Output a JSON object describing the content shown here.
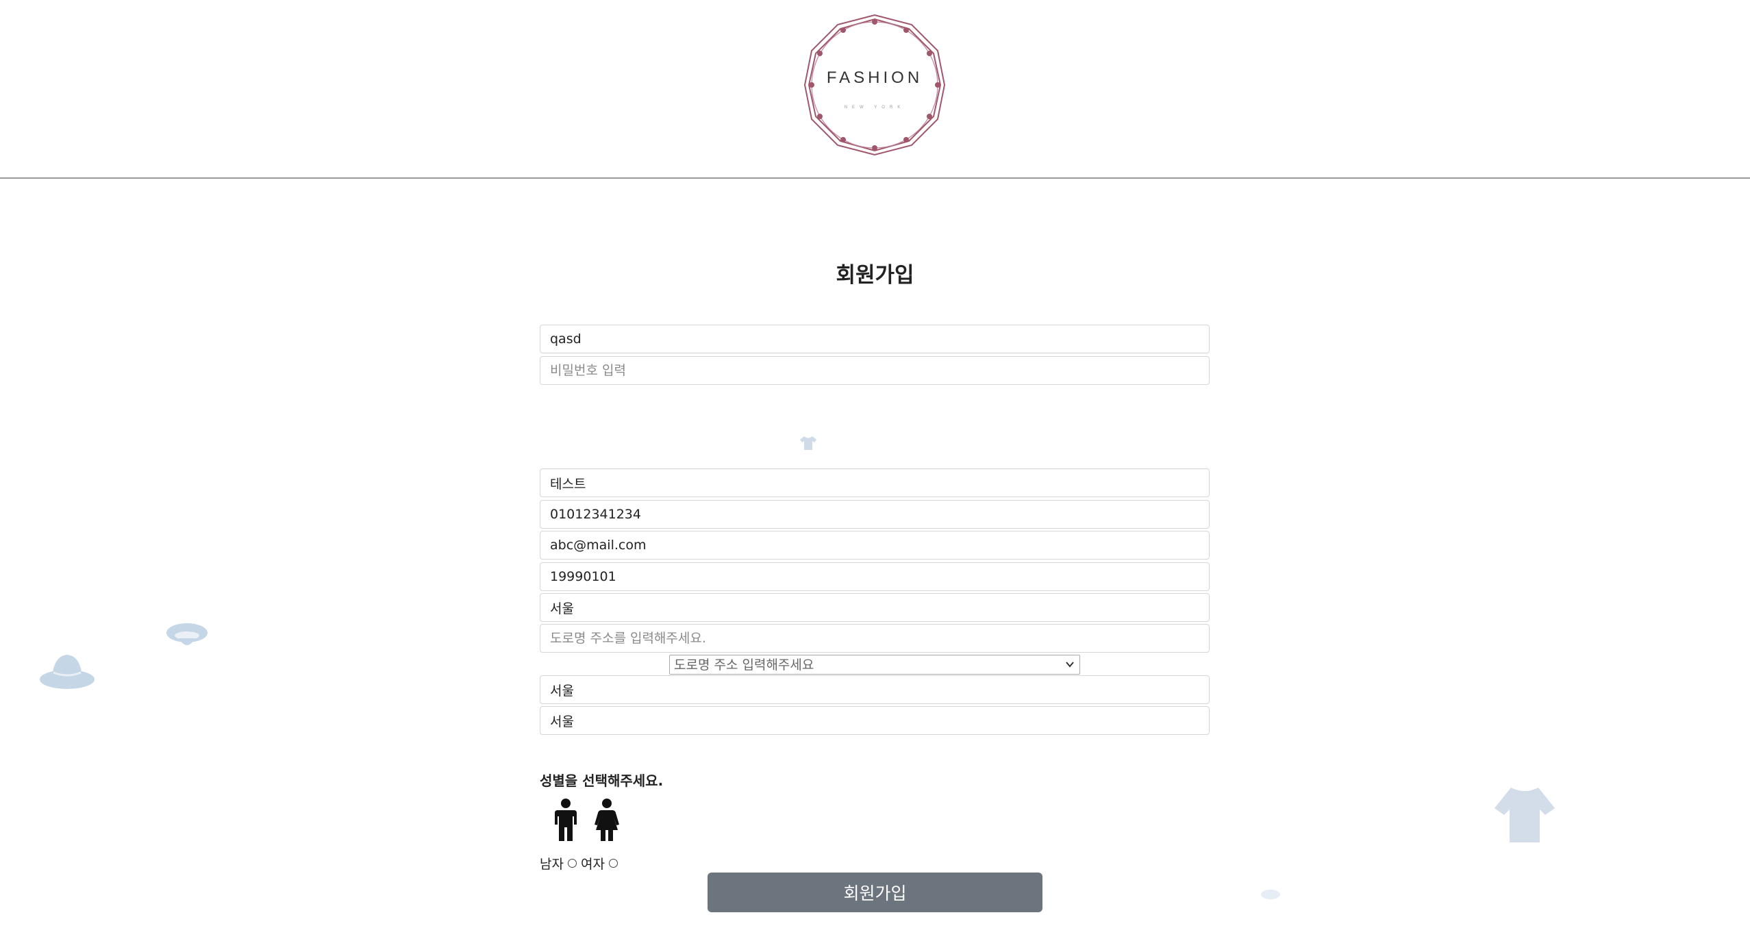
{
  "logo": {
    "name": "FASHION",
    "sub": "NEW YORK"
  },
  "title": "회원가입",
  "form": {
    "userid": {
      "value": "qasd",
      "placeholder": ""
    },
    "password": {
      "value": "",
      "placeholder": "비밀번호 입력"
    },
    "name": {
      "value": "테스트"
    },
    "phone": {
      "value": "01012341234"
    },
    "email": {
      "value": "abc@mail.com"
    },
    "birth": {
      "value": "19990101"
    },
    "city": {
      "value": "서울"
    },
    "road_address": {
      "value": "",
      "placeholder": "도로명 주소를 입력해주세요."
    },
    "road_select": {
      "selected": "도로명 주소 입력해주세요"
    },
    "address_detail_1": {
      "value": "서울"
    },
    "address_detail_2": {
      "value": "서울"
    }
  },
  "gender": {
    "label": "성별을 선택해주세요.",
    "male": "남자",
    "female": "여자"
  },
  "submit_label": "회원가입",
  "colors": {
    "button": "#6c757d",
    "logo_accent": "#a0566b",
    "decoration": "#c9d7e6"
  },
  "icons": [
    "logo-emblem",
    "male-person-icon",
    "female-person-icon",
    "hat-icon",
    "cap-icon",
    "shirt-icon",
    "chevron-down-icon"
  ]
}
